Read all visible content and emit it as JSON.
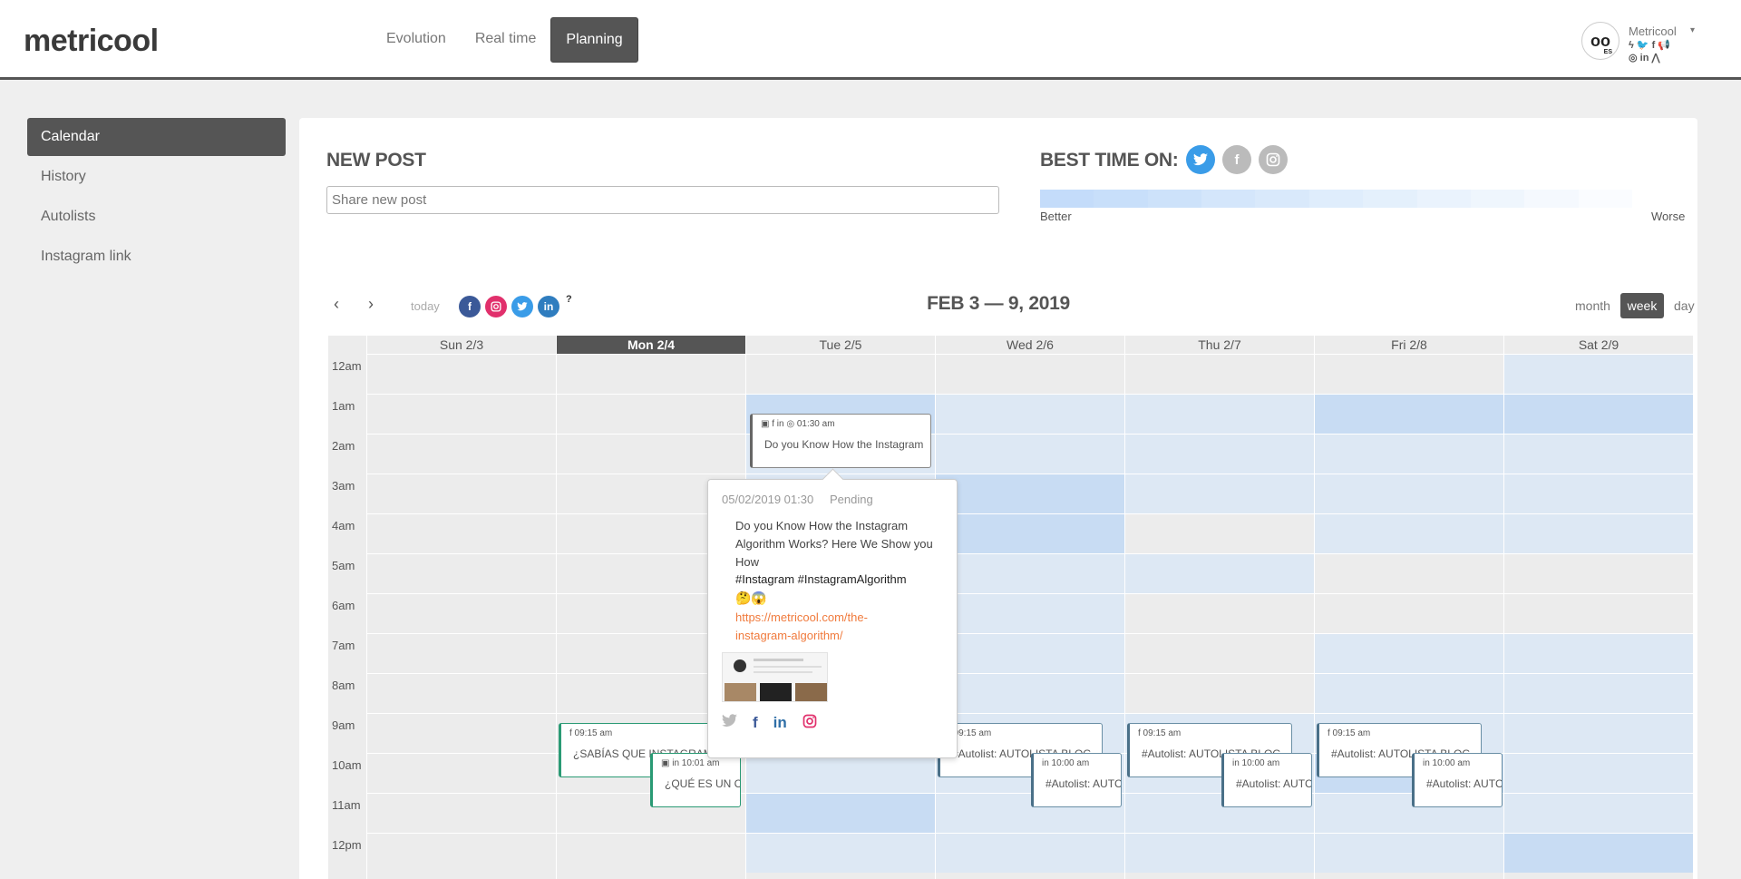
{
  "header": {
    "logo": "metricool",
    "nav": [
      "Evolution",
      "Real time",
      "Planning"
    ],
    "account": {
      "name": "Metricool",
      "caret": "▾",
      "avatar": "oo",
      "avatar_badge": "ES",
      "icons_row1": "ϟ 🐦 f 📢",
      "icons_row2": "◎ in ⋀"
    }
  },
  "sidebar": {
    "items": [
      "Calendar",
      "History",
      "Autolists",
      "Instagram link"
    ]
  },
  "new_post": {
    "title": "NEW POST",
    "placeholder": "Share new post"
  },
  "best_time": {
    "title": "BEST TIME ON:",
    "networks": [
      "twitter",
      "facebook",
      "instagram"
    ],
    "better": "Better",
    "worse": "Worse",
    "scale_colors": [
      "#c4dcfa",
      "#c8dffa",
      "#cde2fa",
      "#d4e6fb",
      "#d9e9fb",
      "#dfedfc",
      "#e4f0fc",
      "#eaf3fd",
      "#eff6fd",
      "#f5f9fe",
      "#fafcff"
    ]
  },
  "calendar": {
    "today_label": "today",
    "prev": "‹",
    "next": "›",
    "help": "?",
    "range": "FEB 3 — 9, 2019",
    "views": [
      "month",
      "week",
      "day"
    ],
    "days": [
      "Sun 2/3",
      "Mon 2/4",
      "Tue 2/5",
      "Wed 2/6",
      "Thu 2/7",
      "Fri 2/8",
      "Sat 2/9"
    ],
    "hours": [
      "12am",
      "1am",
      "2am",
      "3am",
      "4am",
      "5am",
      "6am",
      "7am",
      "8am",
      "9am",
      "10am",
      "11am",
      "12pm"
    ]
  },
  "events": {
    "tue_0130": {
      "meta": "▣ f in ◎ 01:30 am",
      "text": "Do you Know How the Instagram"
    },
    "mon_0915": {
      "meta": "f 09:15 am",
      "text": "¿SABÍAS QUE INSTAGRAM"
    },
    "mon_1001": {
      "meta": "▣ in 10:01 am",
      "text": "¿QUÉ ES UN C"
    },
    "wed_0915": {
      "meta": "f 09:15 am",
      "text": "#Autolist: AUTOLISTA BLOG"
    },
    "wed_1000": {
      "meta": "in 10:00 am",
      "text": "#Autolist: AUTC"
    },
    "thu_0915": {
      "meta": "f 09:15 am",
      "text": "#Autolist: AUTOLISTA BLOG"
    },
    "thu_1000": {
      "meta": "in 10:00 am",
      "text": "#Autolist: AUTC"
    },
    "fri_0915": {
      "meta": "f 09:15 am",
      "text": "#Autolist: AUTOLISTA BLOG"
    },
    "fri_1000": {
      "meta": "in 10:00 am",
      "text": "#Autolist: AUTC"
    }
  },
  "popover": {
    "date": "05/02/2019 01:30",
    "status": "Pending",
    "body": "Do you Know How the Instagram Algorithm Works? Here We Show you How",
    "tags": "#Instagram #InstagramAlgorithm",
    "emoji": "🤔😱",
    "link": "https://metricool.com/the-instagram-algorithm/",
    "networks": [
      "twitter",
      "facebook",
      "linkedin",
      "instagram"
    ]
  }
}
